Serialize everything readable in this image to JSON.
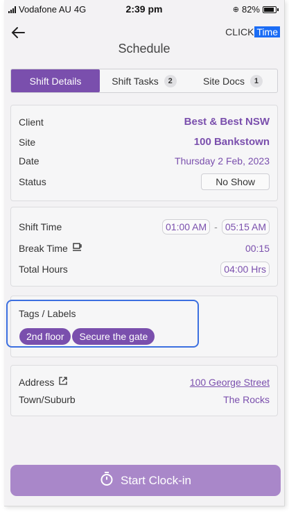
{
  "status_bar": {
    "carrier": "Vodafone AU",
    "network": "4G",
    "time": "2:39 pm",
    "battery": "82%"
  },
  "header": {
    "back_icon": "arrow-left",
    "brand_click": "CLICK",
    "brand_time": "Time",
    "title": "Schedule"
  },
  "tabs": [
    {
      "label": "Shift Details",
      "badge": null,
      "active": true
    },
    {
      "label": "Shift Tasks",
      "badge": "2",
      "active": false
    },
    {
      "label": "Site Docs",
      "badge": "1",
      "active": false
    }
  ],
  "details": {
    "client_label": "Client",
    "client_value": "Best & Best NSW",
    "site_label": "Site",
    "site_value": "100 Bankstown",
    "date_label": "Date",
    "date_value": "Thursday 2 Feb, 2023",
    "status_label": "Status",
    "status_value": "No Show"
  },
  "times": {
    "shift_time_label": "Shift Time",
    "start": "01:00 AM",
    "separator": "-",
    "end": "05:15 AM",
    "break_label": "Break Time",
    "break_value": "00:15",
    "total_label": "Total Hours",
    "total_value": "04:00 Hrs"
  },
  "tags": {
    "title": "Tags / Labels",
    "items": [
      "2nd floor",
      "Secure the gate"
    ]
  },
  "address": {
    "address_label": "Address",
    "address_value": "100 George Street",
    "town_label": "Town/Suburb",
    "town_value": "The Rocks"
  },
  "actions": {
    "start_label": "Start Clock-in"
  },
  "colors": {
    "accent": "#7a4fad",
    "button": "#a987c9",
    "brand_highlight": "#1a6cf5",
    "focus_ring": "#3b6fe0"
  }
}
